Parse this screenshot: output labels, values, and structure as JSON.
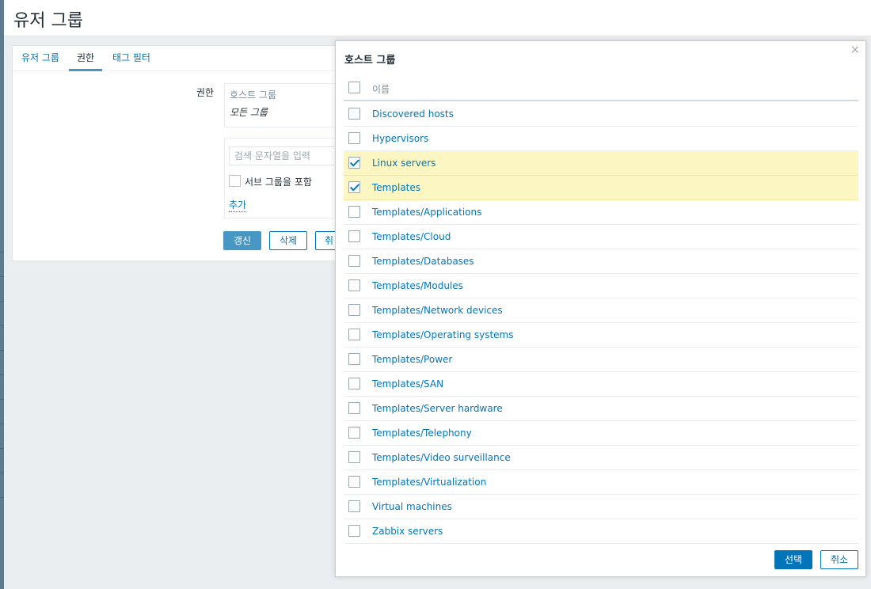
{
  "page": {
    "title": "유저 그룹"
  },
  "tabs": [
    {
      "label": "유저 그룹"
    },
    {
      "label": "권한"
    },
    {
      "label": "태그 필터"
    }
  ],
  "form": {
    "label": "권한",
    "perm_header": "호스트 그룹",
    "perm_value": "모든 그룹",
    "search_placeholder": "검색 문자열을 입력",
    "include_subgroups": "서브 그룹을 포함",
    "add_link": "추가",
    "update_button": "갱신",
    "delete_button": "삭제",
    "cancel_button": "취"
  },
  "modal": {
    "title": "호스트 그룹",
    "close_symbol": "×",
    "column_name": "이름",
    "items": [
      {
        "label": "Discovered hosts",
        "checked": false
      },
      {
        "label": "Hypervisors",
        "checked": false
      },
      {
        "label": "Linux servers",
        "checked": true
      },
      {
        "label": "Templates",
        "checked": true
      },
      {
        "label": "Templates/Applications",
        "checked": false
      },
      {
        "label": "Templates/Cloud",
        "checked": false
      },
      {
        "label": "Templates/Databases",
        "checked": false
      },
      {
        "label": "Templates/Modules",
        "checked": false
      },
      {
        "label": "Templates/Network devices",
        "checked": false
      },
      {
        "label": "Templates/Operating systems",
        "checked": false
      },
      {
        "label": "Templates/Power",
        "checked": false
      },
      {
        "label": "Templates/SAN",
        "checked": false
      },
      {
        "label": "Templates/Server hardware",
        "checked": false
      },
      {
        "label": "Templates/Telephony",
        "checked": false
      },
      {
        "label": "Templates/Video surveillance",
        "checked": false
      },
      {
        "label": "Templates/Virtualization",
        "checked": false
      },
      {
        "label": "Virtual machines",
        "checked": false
      },
      {
        "label": "Zabbix servers",
        "checked": false
      }
    ],
    "select_button": "선택",
    "cancel_button": "취소"
  },
  "colors": {
    "link": "#0275b8",
    "selected_row": "#fcf7c2",
    "primary_button": "#0275b8"
  }
}
